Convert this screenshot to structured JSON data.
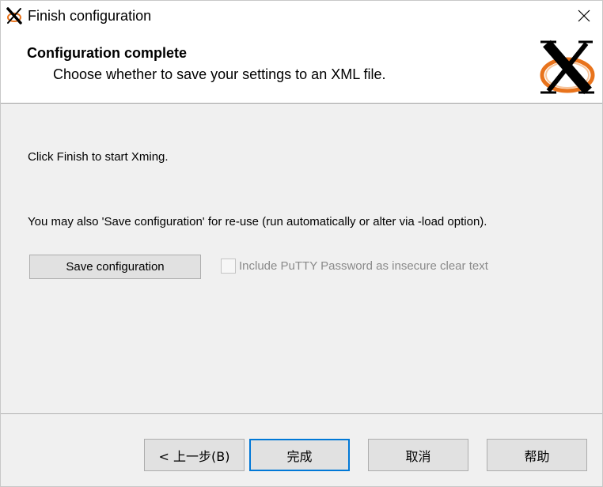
{
  "window": {
    "title": "Finish configuration",
    "close_label": "close"
  },
  "header": {
    "title": "Configuration complete",
    "subtitle": "Choose whether to save your settings to an XML file.",
    "logo": "xming-logo"
  },
  "main": {
    "finish_text": "Click Finish to start Xming.",
    "save_text": "You may also 'Save configuration' for re-use (run automatically or alter via -load option).",
    "save_button_label": "Save configuration",
    "checkbox_label": "Include PuTTY Password as insecure clear text",
    "checkbox_checked": false,
    "checkbox_enabled": false
  },
  "footer": {
    "back_label": "< 上一步(B)",
    "finish_label": "完成",
    "cancel_label": "取消",
    "help_label": "帮助"
  },
  "colors": {
    "accent": "#0078d7",
    "logo_orange": "#e8731c"
  }
}
